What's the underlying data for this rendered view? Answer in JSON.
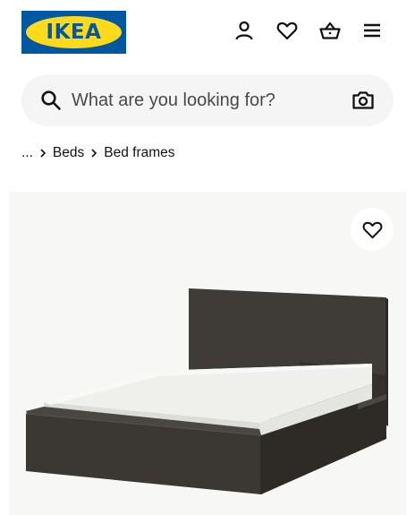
{
  "header": {
    "logo_text": "IKEA",
    "icons": [
      "account-icon",
      "heart-icon",
      "basket-icon",
      "menu-icon"
    ]
  },
  "search": {
    "placeholder": "What are you looking for?",
    "icon": "search-icon",
    "camera_icon": "camera-icon"
  },
  "breadcrumb": {
    "items": [
      "...",
      "Beds",
      "Bed frames"
    ],
    "separator_icon": "chevron-right-icon"
  },
  "product": {
    "favorite_icon": "heart-icon",
    "image": "bed-frame-image"
  },
  "colors": {
    "brand_blue": "#0058a3",
    "brand_yellow": "#ffda1a",
    "search_bg": "#f5f5f5",
    "bed_frame": "#3e3a35",
    "mattress": "#eeeeeb"
  }
}
